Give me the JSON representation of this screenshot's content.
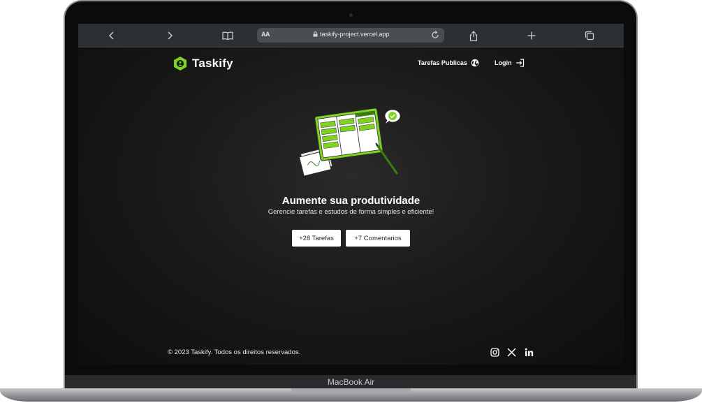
{
  "device": {
    "label": "MacBook Air"
  },
  "browser": {
    "text_size_label": "AA",
    "url": "taskify-project.vercel.app"
  },
  "header": {
    "logo_text": "Taskify",
    "public_tasks_label": "Tarefas Publicas",
    "login_label": "Login"
  },
  "hero": {
    "title": "Aumente sua produtividade",
    "subtitle": "Gerencie tarefas e estudos de forma simples e eficiente!",
    "stats": [
      "+28 Tarefas",
      "+7 Comentarios"
    ]
  },
  "footer": {
    "copyright": "© 2023 Taskify. Todos os direitos reservados.",
    "social_icons": [
      "instagram-icon",
      "x-icon",
      "linkedin-icon"
    ]
  },
  "colors": {
    "accent": "#7ed321",
    "accent_dark": "#3a7d0c",
    "background": "#141414",
    "safari_bar": "#2c2f33"
  }
}
